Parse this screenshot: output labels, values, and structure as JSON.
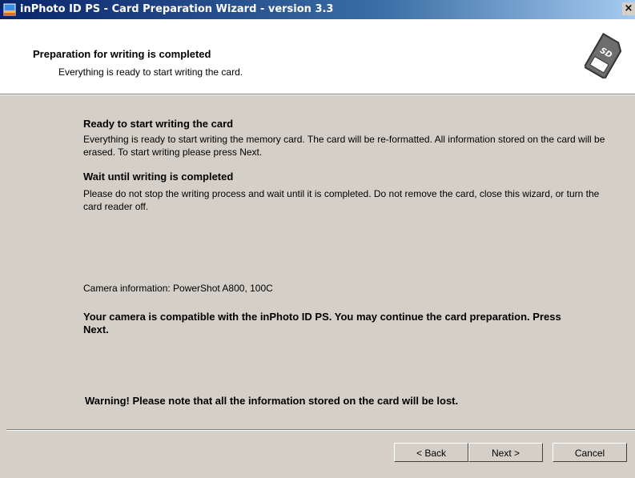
{
  "window": {
    "title": "inPhoto ID PS - Card Preparation Wizard - version 3.3",
    "close_glyph": "×"
  },
  "header": {
    "title": "Preparation for writing is completed",
    "subtitle": "Everything is ready to start writing the card.",
    "icon": "sd-card-icon",
    "icon_glyph": "SD"
  },
  "body": {
    "section1": {
      "title": "Ready to start writing the card",
      "text": "Everything is ready to start writing the memory card. The card will be re-formatted. All information stored on the card will be erased. To start writing please press Next."
    },
    "section2": {
      "title": "Wait until writing is completed",
      "text": "Please do not stop the writing process and wait until it is completed. Do not remove the card, close this wizard, or turn the card reader off."
    },
    "camera_info": "Camera information: PowerShot A800, 100C",
    "compat_message": "Your camera is compatible with the inPhoto ID PS. You may continue the card preparation. Press Next.",
    "warning": "Warning! Please note that all the information stored on the card will be lost."
  },
  "buttons": {
    "back": "< Back",
    "next": "Next >",
    "cancel": "Cancel"
  },
  "colors": {
    "titlebar": "#0a246a",
    "dialog_bg": "#d4d0c8",
    "header_bg": "#ffffff"
  }
}
